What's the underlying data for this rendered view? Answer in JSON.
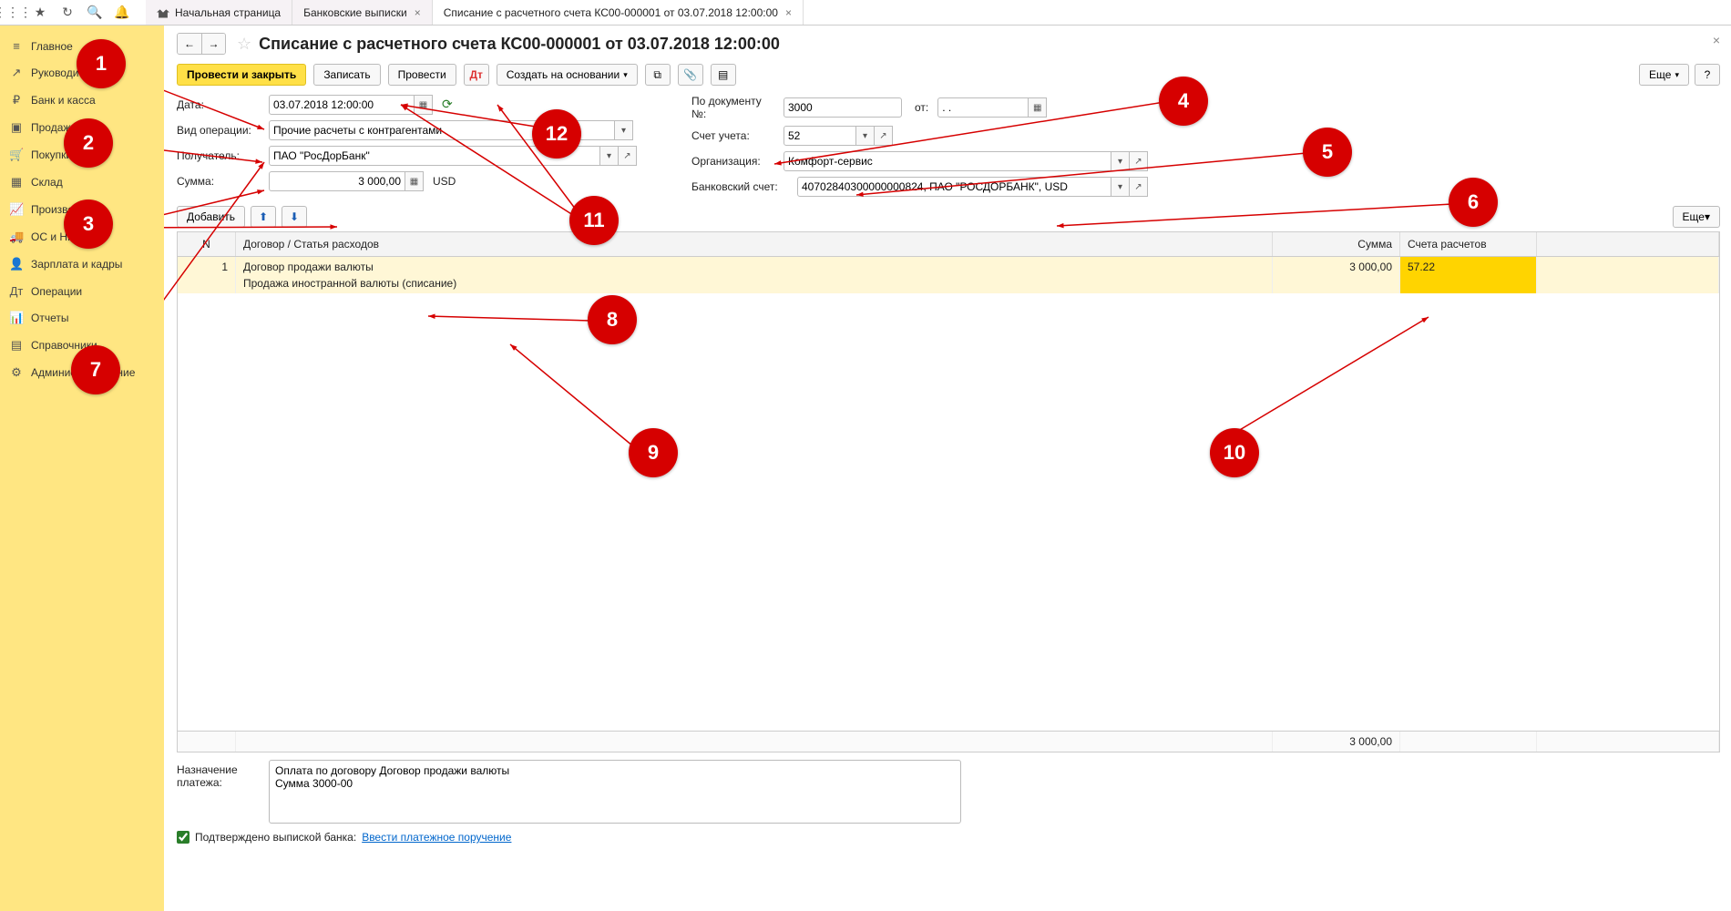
{
  "tabs": {
    "home": "Начальная страница",
    "bank": "Банковские выписки",
    "doc": "Списание с расчетного счета КС00-000001 от 03.07.2018 12:00:00"
  },
  "nav": {
    "items": [
      {
        "icon": "≡",
        "label": "Главное"
      },
      {
        "icon": "↗",
        "label": "Руководителю"
      },
      {
        "icon": "₽",
        "label": "Банк и касса"
      },
      {
        "icon": "▣",
        "label": "Продажи"
      },
      {
        "icon": "🛒",
        "label": "Покупки"
      },
      {
        "icon": "▦",
        "label": "Склад"
      },
      {
        "icon": "📈",
        "label": "Производство"
      },
      {
        "icon": "🚚",
        "label": "ОС и НМА"
      },
      {
        "icon": "👤",
        "label": "Зарплата и кадры"
      },
      {
        "icon": "Дт",
        "label": "Операции"
      },
      {
        "icon": "📊",
        "label": "Отчеты"
      },
      {
        "icon": "▤",
        "label": "Справочники"
      },
      {
        "icon": "⚙",
        "label": "Администрирование"
      }
    ]
  },
  "title": "Списание с расчетного счета КС00-000001 от 03.07.2018 12:00:00",
  "cmd": {
    "post_close": "Провести и закрыть",
    "write": "Записать",
    "post": "Провести",
    "create_based": "Создать на основании",
    "more": "Еще",
    "help": "?"
  },
  "form": {
    "date_label": "Дата:",
    "date": "03.07.2018 12:00:00",
    "docnum_label": "По документу №:",
    "docnum": "3000",
    "docfrom_label": "от:",
    "docfrom": ". .",
    "optype_label": "Вид операции:",
    "optype": "Прочие расчеты с контрагентами",
    "acct_label": "Счет учета:",
    "acct": "52",
    "payee_label": "Получатель:",
    "payee": "ПАО \"РосДорБанк\"",
    "org_label": "Организация:",
    "org": "Комфорт-сервис",
    "sum_label": "Сумма:",
    "sum": "3 000,00",
    "currency": "USD",
    "bankacct_label": "Банковский счет:",
    "bankacct": "40702840300000000824, ПАО \"РОСДОРБАНК\", USD"
  },
  "tbltool": {
    "add": "Добавить",
    "more": "Еще"
  },
  "table": {
    "col_n": "N",
    "col_desc": "Договор / Статья расходов",
    "col_sum": "Сумма",
    "col_acc": "Счета расчетов",
    "row_n": "1",
    "row_contract": "Договор продажи валюты",
    "row_expense": "Продажа иностранной валюты (списание)",
    "row_sum": "3 000,00",
    "row_acc": "57.22",
    "foot_sum": "3 000,00"
  },
  "bottom": {
    "purpose_label": "Назначение платежа:",
    "purpose": "Оплата по договору Договор продажи валюты\nСумма 3000-00",
    "confirmed": "Подтверждено выпиской банка:",
    "enter_order": "Ввести платежное поручение"
  },
  "callouts": [
    "1",
    "2",
    "3",
    "4",
    "5",
    "6",
    "7",
    "8",
    "9",
    "10",
    "11",
    "12"
  ]
}
